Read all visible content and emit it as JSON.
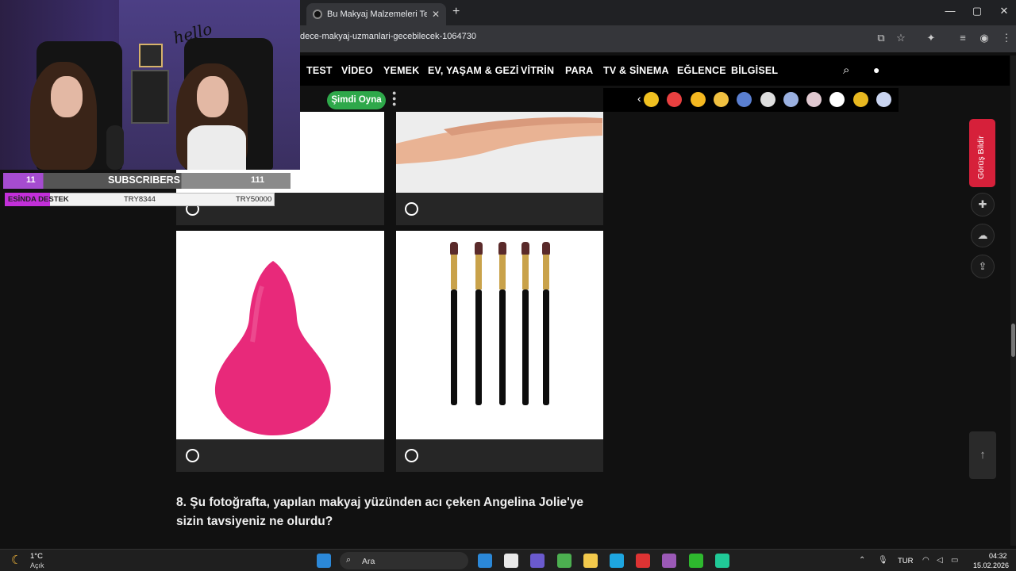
{
  "browser": {
    "tab_title": "Bu Makyaj Malzemeleri Testind",
    "tab_close": "✕",
    "new_tab": "+",
    "url": "dece-makyaj-uzmanlari-gecebilecek-1064730",
    "window_controls": [
      "—",
      "▢",
      "✕"
    ],
    "toolbar_icons": [
      "install-icon",
      "star-icon",
      "extensions-icon",
      "media-icon",
      "profile-icon",
      "menu-icon"
    ]
  },
  "site": {
    "nav": [
      "TEST",
      "VİDEO",
      "YEMEK",
      "EV, YAŞAM & GEZİ",
      "VİTRİN",
      "PARA",
      "TV & SİNEMA",
      "EĞLENCE",
      "BİLGİSEL"
    ],
    "play_button": "Şimdi Oyna",
    "feedback_button": "Görüş Bildir",
    "emoji_colors": [
      "#f0c020",
      "#e84040",
      "#f5b820",
      "#f0c040",
      "#5a7fd0",
      "#dddddd",
      "#9ab0e0",
      "#e0c8d0",
      "#ffffff",
      "#e8b820",
      "#c9d4f0"
    ]
  },
  "quiz": {
    "question": "8. Şu fotoğrafta, yapılan makyaj yüzünden acı çeken Angelina Jolie'ye sizin tavsiyeniz ne olurdu?",
    "options": [
      "sponge",
      "brushes"
    ]
  },
  "stream": {
    "overlay_text": "hello",
    "subscribers_label": "SUBSCRIBERS",
    "subscribers_left": "11",
    "subscribers_right": "111",
    "donation_label": "ESİNDA DESTEK",
    "donation_current": "TRY8344",
    "donation_goal": "TRY50000",
    "donation_progress": 0.167
  },
  "taskbar": {
    "temp": "1°C",
    "weather": "Açık",
    "search": "Ara",
    "lang": "TUR",
    "time": "04:32",
    "date": "15.02.2026",
    "app_colors": [
      "#2b88d8",
      "#e8e8e8",
      "#6a5acd",
      "#4caf50",
      "#f2c94c",
      "#1ea6e0",
      "#d33",
      "#9b59b6",
      "#2eb82e",
      "#20c997"
    ]
  }
}
